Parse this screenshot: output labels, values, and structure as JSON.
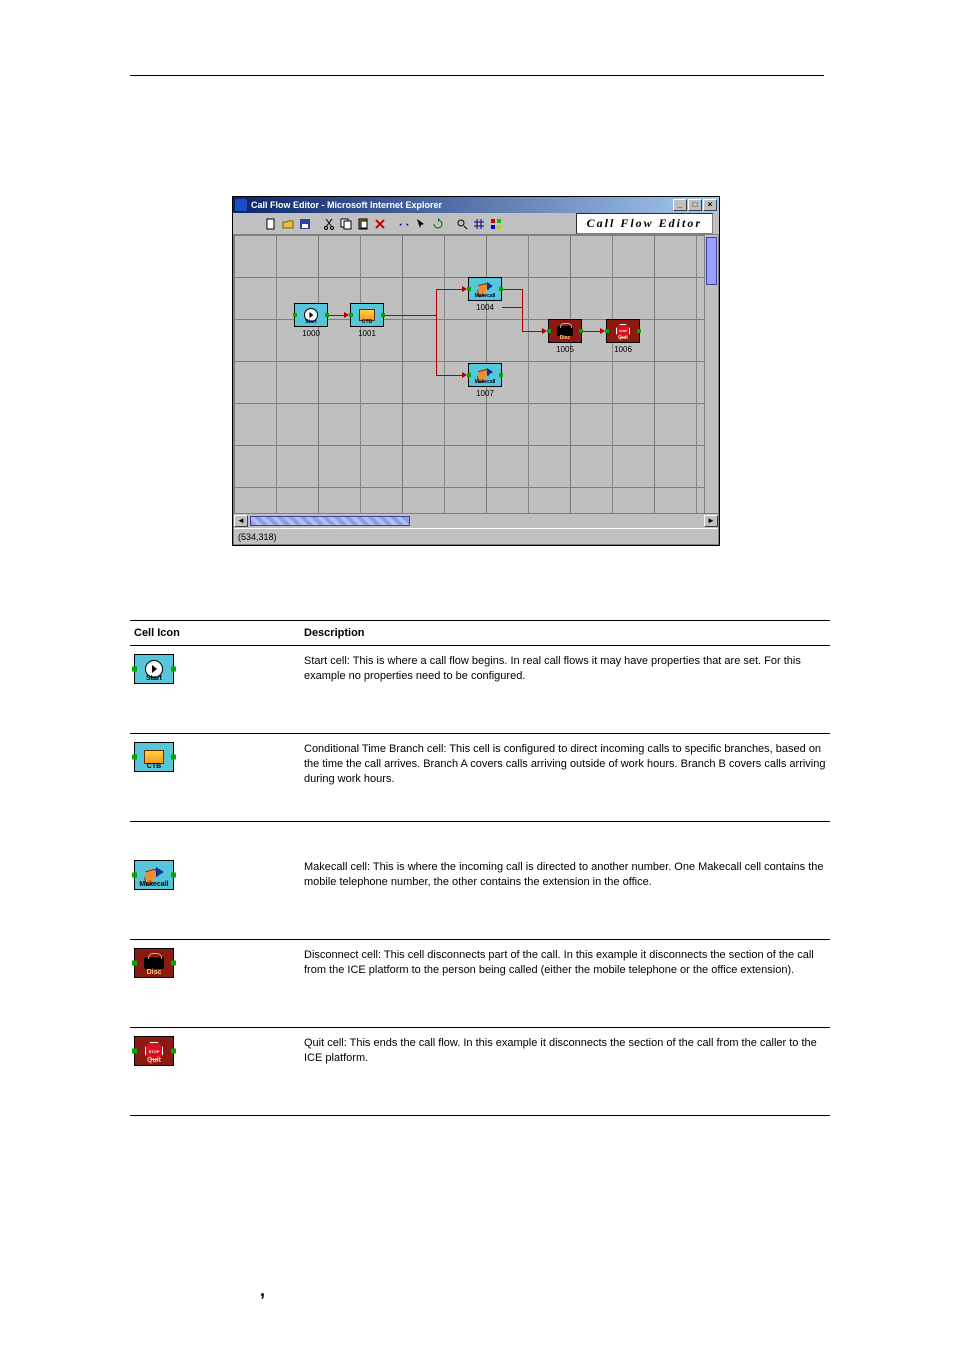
{
  "window": {
    "title": "Call Flow Editor - Microsoft Internet Explorer",
    "brand": "Call Flow Editor",
    "status": "(534,318)",
    "controls": {
      "min": "_",
      "max": "□",
      "close": "×"
    }
  },
  "nodes": {
    "start": {
      "label": "Start",
      "id": "1000"
    },
    "ctb": {
      "label": "CTB",
      "id": "1001"
    },
    "make1": {
      "label": "Makecall",
      "id": "1004"
    },
    "make2": {
      "label": "Makecall",
      "id": "1007"
    },
    "disc": {
      "label": "Disc",
      "id": "1005"
    },
    "quit": {
      "label": "Quit",
      "id": "1006"
    }
  },
  "table": {
    "headers": {
      "icon": "Cell Icon",
      "desc": "Description"
    },
    "rows": [
      {
        "key": "start",
        "chip_label": "Start",
        "desc": "Start cell: This is where a call flow begins. In real call flows it may have properties that are set. For this example no properties need to be configured."
      },
      {
        "key": "ctb",
        "chip_label": "CTB",
        "desc": "Conditional Time Branch cell: This cell is configured to direct incoming calls to specific branches, based on the time the call arrives. Branch A covers calls arriving outside of work hours. Branch B covers calls arriving during work hours."
      },
      {
        "key": "makecall",
        "chip_label": "Makecall",
        "desc": "Makecall cell: This is where the incoming call is directed to another number. One Makecall cell contains the mobile telephone number, the other contains the extension in the office."
      },
      {
        "key": "disc",
        "chip_label": "Disc",
        "desc": "Disconnect cell: This cell disconnects part of the call. In this example it disconnects the section of the call from the ICE platform to the person being called (either the mobile telephone or the office extension)."
      },
      {
        "key": "quit",
        "chip_label": "Quit",
        "desc": "Quit cell: This ends the call flow. In this example it disconnects the section of the call from the caller to the ICE platform."
      }
    ]
  },
  "stray": {
    "comma": ","
  }
}
